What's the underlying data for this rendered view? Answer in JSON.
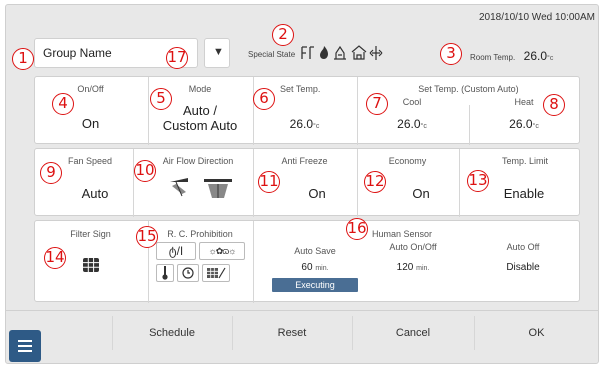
{
  "datetime": "2018/10/10 Wed 10:00AM",
  "group": {
    "name": "Group Name"
  },
  "special_state": {
    "label": "Special State",
    "icons": [
      "defrost-icon",
      "flame-icon",
      "standby-icon",
      "house-icon",
      "diamond-arrows-icon"
    ]
  },
  "room_temp": {
    "label": "Room Temp.",
    "value": "26.0",
    "unit": "°c"
  },
  "callouts": [
    "1",
    "2",
    "3",
    "4",
    "5",
    "6",
    "7",
    "8",
    "9",
    "10",
    "11",
    "12",
    "13",
    "14",
    "15",
    "16",
    "17"
  ],
  "row1": {
    "onoff": {
      "label": "On/Off",
      "value": "On"
    },
    "mode": {
      "label": "Mode",
      "value_line1": "Auto /",
      "value_line2": "Custom Auto"
    },
    "set_temp": {
      "label": "Set Temp.",
      "value": "26.0",
      "unit": "°c"
    },
    "custom_auto": {
      "label": "Set Temp. (Custom Auto)",
      "cool_label": "Cool",
      "cool_value": "26.0",
      "heat_label": "Heat",
      "heat_value": "26.0",
      "unit": "°c"
    }
  },
  "row2": {
    "fan_speed": {
      "label": "Fan Speed",
      "value": "Auto"
    },
    "air_flow": {
      "label": "Air Flow Direction"
    },
    "anti_freeze": {
      "label": "Anti Freeze",
      "value": "On"
    },
    "economy": {
      "label": "Economy",
      "value": "On"
    },
    "temp_limit": {
      "label": "Temp. Limit",
      "value": "Enable"
    }
  },
  "row3": {
    "filter_sign": {
      "label": "Filter Sign"
    },
    "rc_prohibition": {
      "label": "R. C. Prohibition",
      "onoff_text": "ტ/I",
      "mode_text": "☼✿ɷ☼"
    },
    "human_sensor": {
      "label": "Human Sensor",
      "auto_save_label": "Auto Save",
      "auto_save_value": "60",
      "auto_save_unit": "min.",
      "auto_onoff_label": "Auto On/Off",
      "auto_onoff_value": "120",
      "auto_onoff_unit": "min.",
      "auto_off_label": "Auto Off",
      "auto_off_value": "Disable",
      "status": "Executing"
    }
  },
  "buttons": {
    "schedule": "Schedule",
    "reset": "Reset",
    "cancel": "Cancel",
    "ok": "OK"
  },
  "colors": {
    "accent": "#4a6e94",
    "callout": "#dd1111"
  }
}
